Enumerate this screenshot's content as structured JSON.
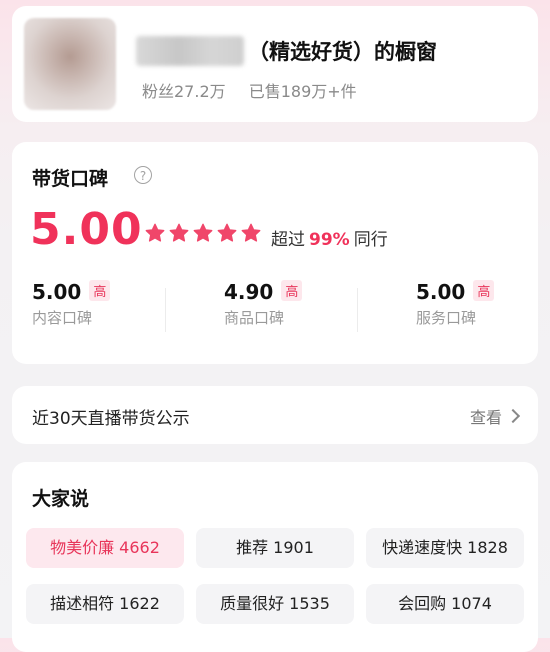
{
  "header": {
    "shop_title": "（精选好货）的橱窗",
    "fans": "粉丝27.2万",
    "sold": "已售189万+件"
  },
  "rating": {
    "title": "带货口碑",
    "help_icon": "?",
    "score": "5.00",
    "stars": 5,
    "exceed_prefix": "超过",
    "exceed_pct": "99%",
    "exceed_suffix": "同行",
    "metrics": [
      {
        "value": "5.00",
        "badge": "高",
        "label": "内容口碑"
      },
      {
        "value": "4.90",
        "badge": "高",
        "label": "商品口碑"
      },
      {
        "value": "5.00",
        "badge": "高",
        "label": "服务口碑"
      }
    ]
  },
  "live": {
    "label": "近30天直播带货公示",
    "view": "查看"
  },
  "comments": {
    "title": "大家说",
    "tags": [
      {
        "text": "物美价廉 4662"
      },
      {
        "text": "推荐 1901"
      },
      {
        "text": "快递速度快 1828"
      },
      {
        "text": "描述相符 1622"
      },
      {
        "text": "质量很好 1535"
      },
      {
        "text": "会回购 1074"
      }
    ]
  },
  "colors": {
    "accent": "#f0325a",
    "star": "#f0466a",
    "badge_bg": "#fde7ec"
  }
}
